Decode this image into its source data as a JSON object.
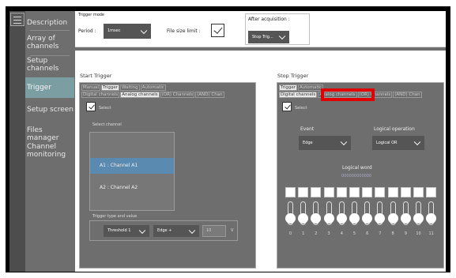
{
  "sidebar": {
    "items": [
      {
        "label": "Description",
        "active": false
      },
      {
        "label": "Array of channels",
        "active": false
      },
      {
        "label": "Setup channels",
        "active": false
      },
      {
        "label": "Trigger",
        "active": true
      },
      {
        "label": "Setup screen",
        "active": false
      },
      {
        "label": "Files manager",
        "active": false
      },
      {
        "label": "Channel monitoring",
        "active": false
      }
    ]
  },
  "topbar": {
    "title": "Trigger mode",
    "period_label": "Period :",
    "period_value": "1msec",
    "filesize_label": "File size limit :",
    "after_acq_label": "After acquisition :",
    "after_acq_value": "Stop Trig..."
  },
  "start_trigger": {
    "title": "Start Trigger",
    "tabs_row1": [
      "Manual",
      "Trigger",
      "Waiting",
      "Automatic"
    ],
    "tabs_row2": [
      "Digital channels",
      "Analog channels",
      "(OR) Channels",
      "(AND) Chan"
    ],
    "select_label": "Select",
    "select_channel_label": "Select channel",
    "channels": [
      "A1 : Channel A1",
      "A2 : Channel A2"
    ],
    "selected_channel": 0,
    "trigger_type_label": "Trigger type and value",
    "threshold_value": "Threshold 1",
    "edge_value": "Edge +",
    "value_placeholder": "10",
    "unit": "V"
  },
  "stop_trigger": {
    "title": "Stop Trigger",
    "tabs_row1": [
      "Trigger",
      "Automatic"
    ],
    "tabs_row2": [
      "Digital channels",
      "Analog channels",
      "(OR) Channels",
      "(AND) Chan"
    ],
    "highlighted_tab": "Analog channels",
    "select_label": "Select",
    "event_label": "Event",
    "event_value": "Edge",
    "logical_operation_label": "Logical operation",
    "logical_operation_value": "Logical OR",
    "logical_word_label": "Logical word",
    "logical_word_value": "000000000000",
    "bits": [
      "0",
      "1",
      "2",
      "3",
      "4",
      "5",
      "6",
      "7",
      "8",
      "9",
      "10",
      "11"
    ]
  },
  "colors": {
    "panel_gray": "#6e6e6e",
    "active_nav": "#7a9ea2",
    "selected_channel": "#5a8ab0",
    "highlight_red": "#e00000"
  }
}
